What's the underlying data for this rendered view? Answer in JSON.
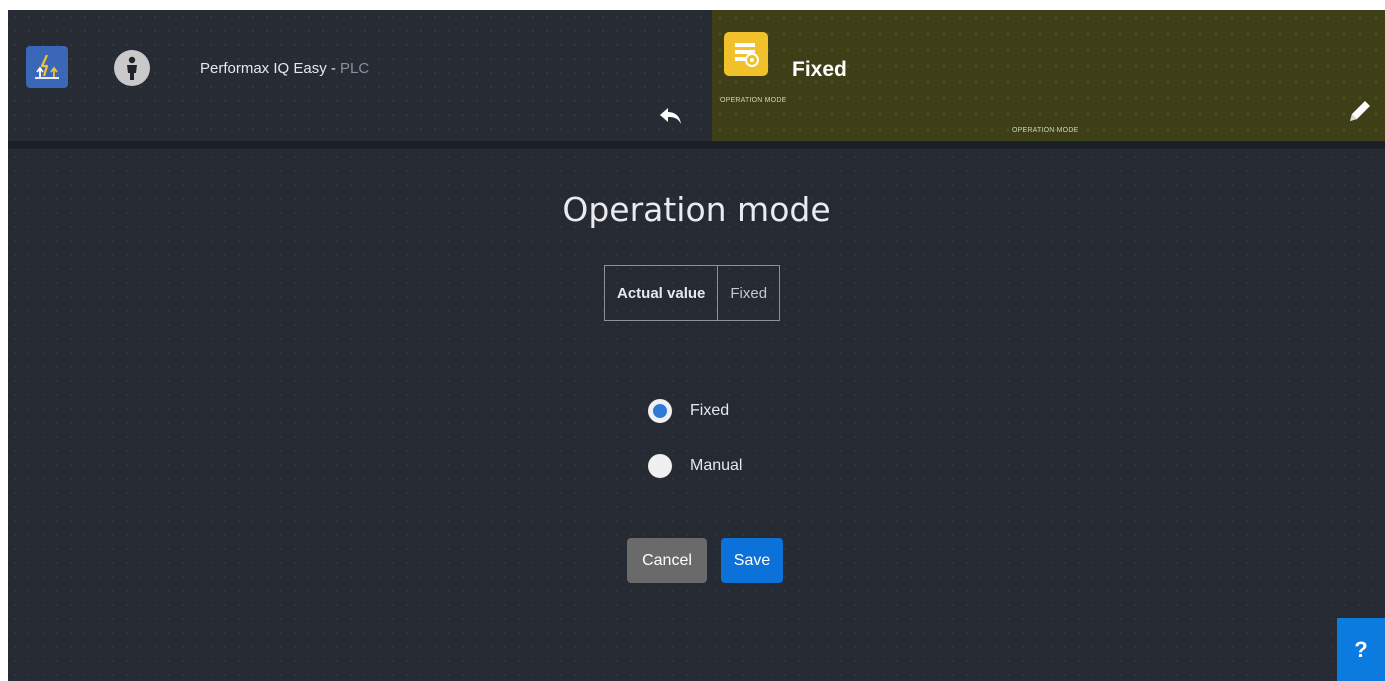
{
  "header": {
    "app_icon": "lightning-arrows-icon",
    "person_icon": "person-icon",
    "device_name": "Performax IQ Easy - ",
    "device_sub": "PLC",
    "back_icon": "undo-arrow-icon"
  },
  "mode_tile": {
    "icon": "settings-list-icon",
    "value": "Fixed",
    "caption": "OPERATION MODE",
    "caption_secondary": "OPERATION MODE",
    "edit_icon": "pencil-icon",
    "background_color": "#3e3f17",
    "icon_color": "#f1c12b"
  },
  "panel": {
    "title": "Operation mode",
    "actual_value_label": "Actual value",
    "actual_value": "Fixed",
    "options": [
      {
        "label": "Fixed",
        "selected": true
      },
      {
        "label": "Manual",
        "selected": false
      }
    ],
    "cancel_label": "Cancel",
    "save_label": "Save"
  },
  "help": {
    "label": "?"
  },
  "colors": {
    "background": "#252a33",
    "accent": "#0c71d9",
    "cancel": "#6a6a6a"
  }
}
